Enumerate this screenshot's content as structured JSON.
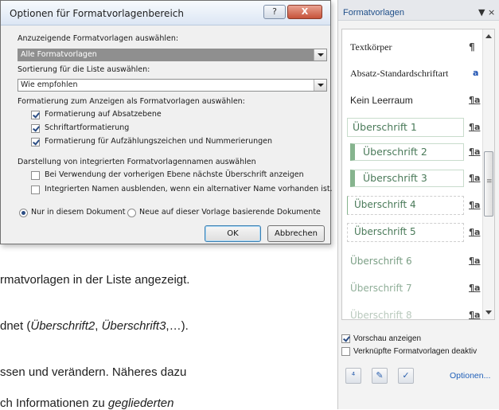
{
  "document": {
    "line1": "rmatvorlagen in der Liste angezeigt.",
    "line2_pre": "dnet (",
    "line2_i1": "Überschrift2",
    "line2_mid": ", ",
    "line2_i2": "Überschrift3",
    "line2_post": ",…).",
    "line3": "ssen und verändern. Näheres dazu",
    "line4_pre": "ch Informationen zu ",
    "line4_i": "gegliederten"
  },
  "dialog": {
    "title": "Optionen für Formatvorlagenbereich",
    "help_label": "?",
    "close_label": "X",
    "select_label": "Anzuzeigende Formatvorlagen auswählen:",
    "select_value": "Alle Formatvorlagen",
    "sort_label": "Sortierung für die Liste auswählen:",
    "sort_value": "Wie empfohlen",
    "format_label": "Formatierung zum Anzeigen als Formatvorlagen auswählen:",
    "checks": [
      {
        "label": "Formatierung auf Absatzebene",
        "checked": true
      },
      {
        "label": "Schriftartformatierung",
        "checked": true
      },
      {
        "label": "Formatierung für Aufzählungszeichen und Nummerierungen",
        "checked": true
      }
    ],
    "builtin_label": "Darstellung von integrierten Formatvorlagennamen auswählen",
    "builtin_checks": [
      {
        "label": "Bei Verwendung der vorherigen Ebene nächste Überschrift anzeigen",
        "checked": false
      },
      {
        "label": "Integrierten Namen ausblenden, wenn ein alternativer Name vorhanden ist.",
        "checked": false
      }
    ],
    "radio_doc": "Nur in diesem Dokument",
    "radio_template": "Neue auf dieser Vorlage basierende Dokumente",
    "ok_label": "OK",
    "cancel_label": "Abbrechen"
  },
  "pane": {
    "title": "Formatvorlagen",
    "header_icons": "▼ ×",
    "items": [
      {
        "name": "Textkörper",
        "mark": "¶"
      },
      {
        "name": "Absatz-Standardschriftart",
        "mark": "a"
      },
      {
        "name": "Kein Leerraum",
        "mark": "¶a"
      },
      {
        "name": "Überschrift 1",
        "mark": "¶a"
      },
      {
        "name": "Überschrift 2",
        "mark": "¶a"
      },
      {
        "name": "Überschrift 3",
        "mark": "¶a"
      },
      {
        "name": "Überschrift 4",
        "mark": "¶a"
      },
      {
        "name": "Überschrift 5",
        "mark": "¶a"
      },
      {
        "name": "Überschrift 6",
        "mark": "¶a"
      },
      {
        "name": "Überschrift 7",
        "mark": "¶a"
      },
      {
        "name": "Überschrift 8",
        "mark": "¶a"
      }
    ],
    "preview_label": "Vorschau anzeigen",
    "preview_checked": true,
    "linked_label": "Verknüpfte Formatvorlagen deaktiv",
    "linked_checked": false,
    "options_link": "Optionen..."
  }
}
